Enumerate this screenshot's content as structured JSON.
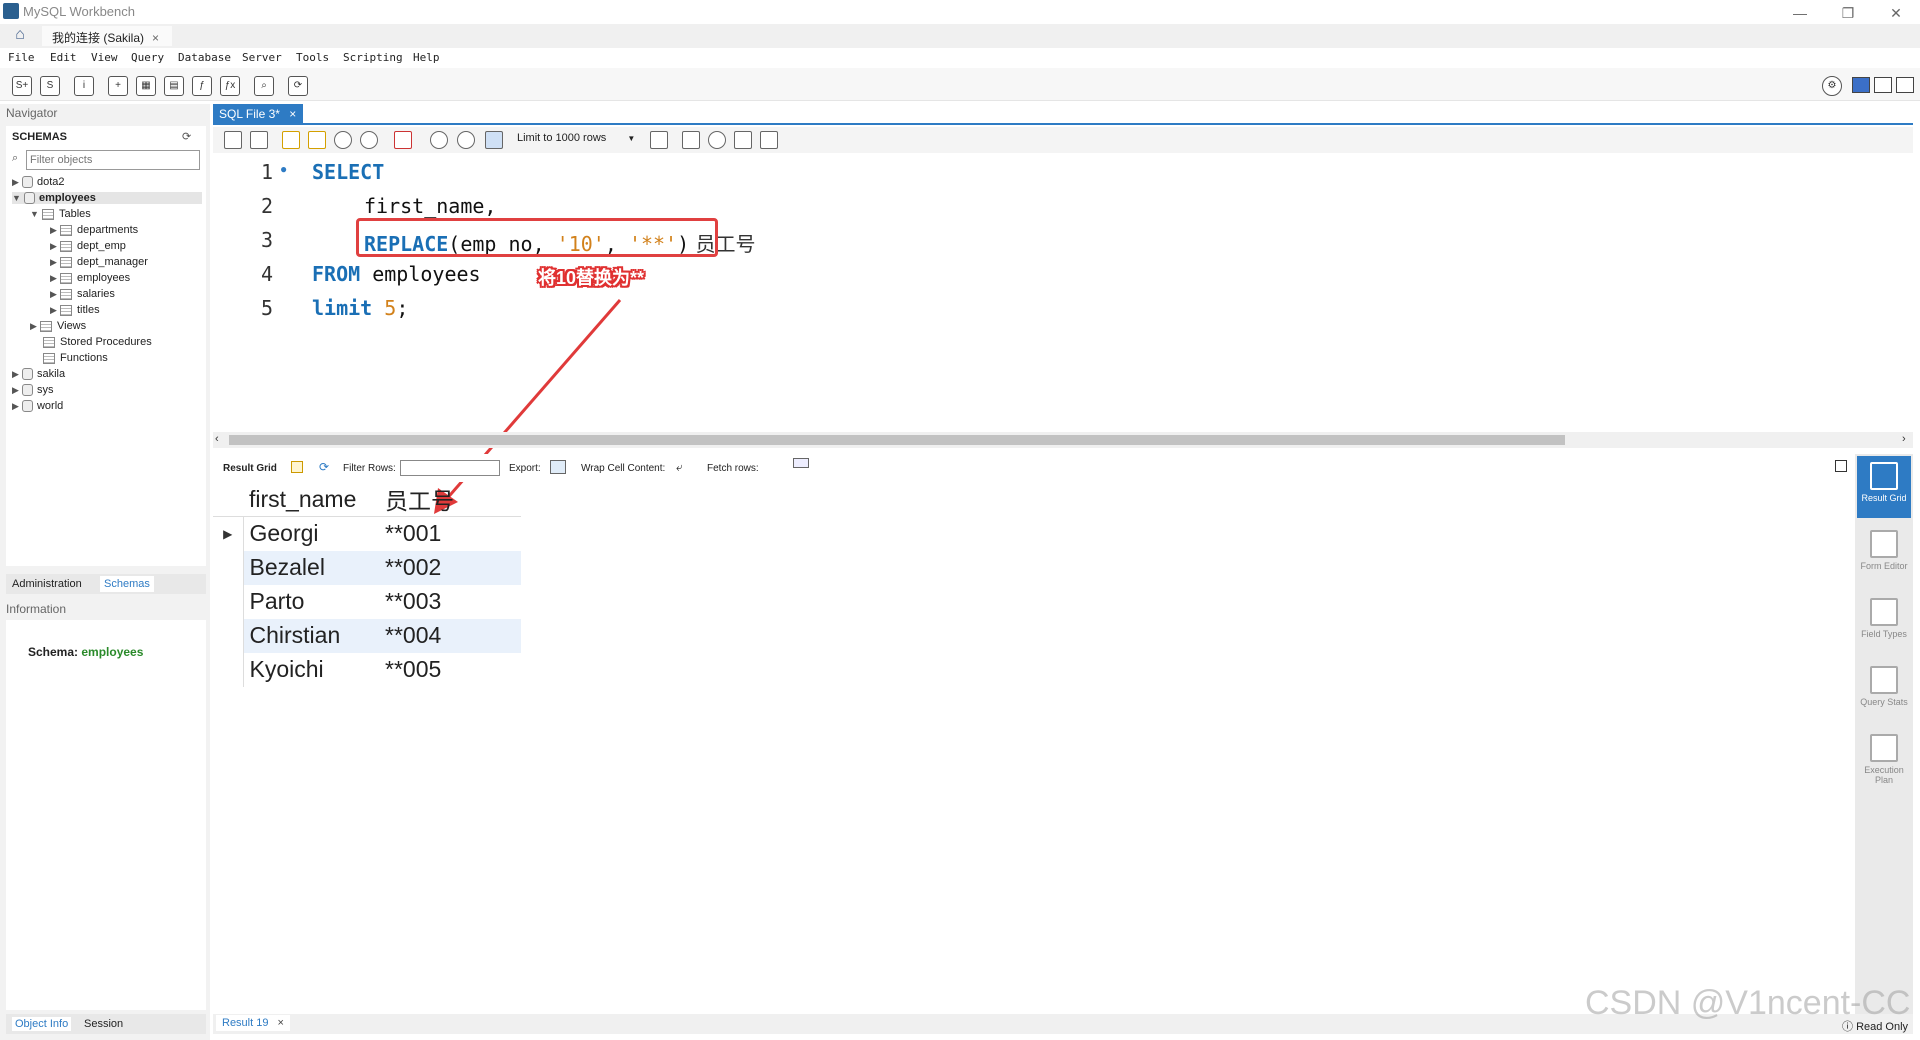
{
  "window": {
    "title": "MySQL Workbench",
    "min": "—",
    "restore": "❐",
    "close": "✕"
  },
  "tabs": {
    "home_icon": "house-icon",
    "connection_tab": "我的连接 (Sakila)",
    "close": "×"
  },
  "menu": [
    "File",
    "Edit",
    "View",
    "Query",
    "Database",
    "Server",
    "Tools",
    "Scripting",
    "Help"
  ],
  "navigator": {
    "header": "Navigator",
    "schemas_title": "SCHEMAS",
    "filter_placeholder": "Filter objects",
    "tree": {
      "dota2": "dota2",
      "employees": "employees",
      "tables": "Tables",
      "t1": "departments",
      "t2": "dept_emp",
      "t3": "dept_manager",
      "t4": "employees",
      "t5": "salaries",
      "t6": "titles",
      "views": "Views",
      "procs": "Stored Procedures",
      "funcs": "Functions",
      "sakila": "sakila",
      "sys": "sys",
      "world": "world"
    },
    "tab_admin": "Administration",
    "tab_schemas": "Schemas",
    "info_header": "Information",
    "schema_label": "Schema:",
    "schema_value": "employees",
    "tab_objinfo": "Object Info",
    "tab_session": "Session"
  },
  "editor": {
    "tab_label": "SQL File 3*",
    "tab_close": "×",
    "limit": "Limit to 1000 rows",
    "lines": [
      "1",
      "2",
      "3",
      "4",
      "5"
    ],
    "code": {
      "select": "SELECT",
      "first_name": "first_name,",
      "replace": "REPLACE",
      "args_open": "(emp_no, ",
      "str1": "'10'",
      "comma": ", ",
      "str2": "'**'",
      "close": ")",
      "alias": " 员工号",
      "from": "FROM",
      "table": " employees",
      "limit": "limit",
      "limit_num": " 5",
      "semicolon": ";"
    },
    "annotation": "将10替换为**"
  },
  "results": {
    "result_grid": "Result Grid",
    "filter_rows": "Filter Rows:",
    "export": "Export:",
    "wrap": "Wrap Cell Content:",
    "fetch": "Fetch rows:",
    "columns": [
      "first_name",
      "员工号"
    ],
    "rows": [
      [
        "Georgi",
        "**001"
      ],
      [
        "Bezalel",
        "**002"
      ],
      [
        "Parto",
        "**003"
      ],
      [
        "Chirstian",
        "**004"
      ],
      [
        "Kyoichi",
        "**005"
      ]
    ]
  },
  "sidebar": {
    "result_grid": "Result Grid",
    "form_editor": "Form Editor",
    "field_types": "Field Types",
    "query_stats": "Query Stats",
    "exec_plan": "Execution Plan"
  },
  "status": {
    "result_tab": "Result 19",
    "close": "×",
    "read_only": "Read Only"
  },
  "watermark": "CSDN @V1ncent-CC"
}
